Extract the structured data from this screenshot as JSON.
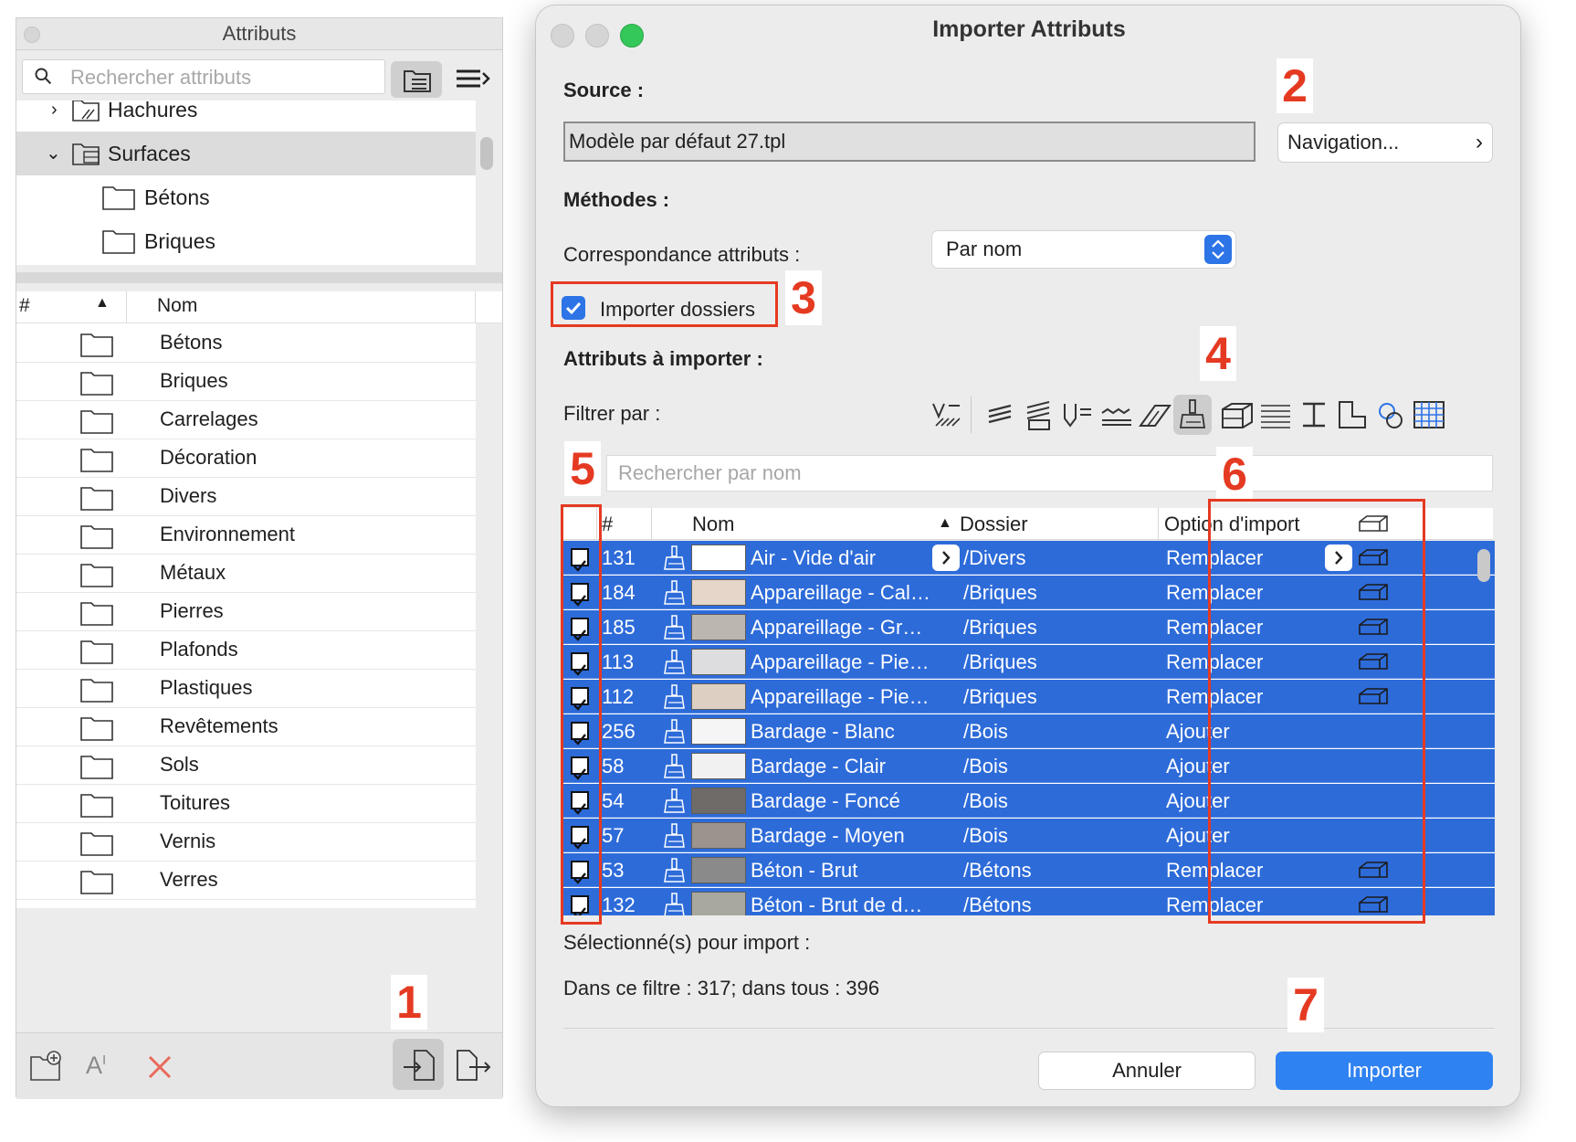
{
  "left_panel": {
    "title": "Attributs",
    "search_placeholder": "Rechercher attributs",
    "tree": [
      {
        "label": "Hachures",
        "expanded": false
      },
      {
        "label": "Surfaces",
        "expanded": true,
        "selected": true
      },
      {
        "label": "Bétons"
      },
      {
        "label": "Briques"
      }
    ],
    "list_header": {
      "num": "#",
      "name": "Nom"
    },
    "list": [
      "Bétons",
      "Briques",
      "Carrelages",
      "Décoration",
      "Divers",
      "Environnement",
      "Métaux",
      "Pierres",
      "Plafonds",
      "Plastiques",
      "Revêtements",
      "Sols",
      "Toitures",
      "Vernis",
      "Verres"
    ]
  },
  "dialog": {
    "title": "Importer Attributs",
    "source_label": "Source :",
    "source_value": "Modèle par défaut 27.tpl",
    "navigation_label": "Navigation...",
    "methods_label": "Méthodes :",
    "correspondance_label": "Correspondance attributs :",
    "correspondance_value": "Par nom",
    "import_folders_label": "Importer dossiers",
    "import_folders_checked": true,
    "attributes_label": "Attributs à importer :",
    "filter_label": "Filtrer par :",
    "search_placeholder": "Rechercher par nom",
    "table_header": {
      "num": "#",
      "name": "Nom",
      "folder": "Dossier",
      "option": "Option d'import"
    },
    "rows": [
      {
        "num": "131",
        "color": "#ffffff",
        "name": "Air - Vide d'air",
        "folder": "/Divers",
        "option": "Remplacer",
        "arrow": true,
        "bld": true
      },
      {
        "num": "184",
        "color": "#e5d6c9",
        "name": "Appareillage - Cal…",
        "folder": "/Briques",
        "option": "Remplacer",
        "bld": true
      },
      {
        "num": "185",
        "color": "#bcb6b1",
        "name": "Appareillage - Gr…",
        "folder": "/Briques",
        "option": "Remplacer",
        "bld": true
      },
      {
        "num": "113",
        "color": "#dddddf",
        "name": "Appareillage - Pie…",
        "folder": "/Briques",
        "option": "Remplacer",
        "bld": true
      },
      {
        "num": "112",
        "color": "#ddcfc2",
        "name": "Appareillage - Pie…",
        "folder": "/Briques",
        "option": "Remplacer",
        "bld": true
      },
      {
        "num": "256",
        "color": "#f5f5f5",
        "name": "Bardage - Blanc",
        "folder": "/Bois",
        "option": "Ajouter",
        "bld": false
      },
      {
        "num": "58",
        "color": "#f2f1f1",
        "name": "Bardage - Clair",
        "folder": "/Bois",
        "option": "Ajouter",
        "bld": false
      },
      {
        "num": "54",
        "color": "#6f6b68",
        "name": "Bardage - Foncé",
        "folder": "/Bois",
        "option": "Ajouter",
        "bld": false
      },
      {
        "num": "57",
        "color": "#9b948e",
        "name": "Bardage - Moyen",
        "folder": "/Bois",
        "option": "Ajouter",
        "bld": false
      },
      {
        "num": "53",
        "color": "#8a8a8a",
        "name": "Béton - Brut",
        "folder": "/Bétons",
        "option": "Remplacer",
        "bld": true
      },
      {
        "num": "132",
        "color": "#a8a89f",
        "name": "Béton - Brut de d…",
        "folder": "/Bétons",
        "option": "Remplacer",
        "bld": true
      }
    ],
    "selected_label": "Sélectionné(s) pour import :",
    "filter_count": "Dans ce filtre : 317; dans tous : 396",
    "cancel_label": "Annuler",
    "import_label": "Importer"
  },
  "annotations": [
    "1",
    "2",
    "3",
    "4",
    "5",
    "6",
    "7"
  ],
  "colors": {
    "accent": "#2d74e7",
    "row_selected": "#2d6bd9",
    "annotation": "#e53a22"
  }
}
